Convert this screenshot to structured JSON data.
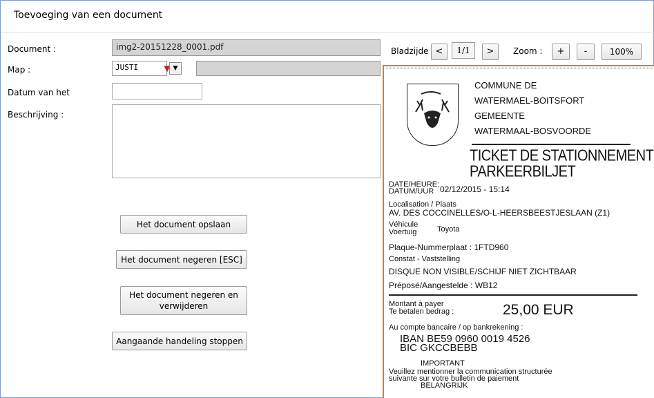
{
  "window": {
    "title": "Toevoeging van een document"
  },
  "form": {
    "document_label": "Document :",
    "document_value": "img2-20151228_0001.pdf",
    "map_label": "Map :",
    "map_value": "JUSTI",
    "date_label": "Datum van het",
    "date_value": "",
    "description_label": "Beschrijving :",
    "description_value": ""
  },
  "actions": {
    "save": "Het document opslaan",
    "ignore": "Het document negeren [ESC]",
    "ignore_delete": "Het document negeren en verwijderen",
    "stop": "Aangaande handeling stoppen"
  },
  "viewer": {
    "page_label": "Bladzijde",
    "prev": "<",
    "page_value": "1/1",
    "next": ">",
    "zoom_label": "Zoom :",
    "zoom_in": "+",
    "zoom_out": "-",
    "zoom_value": "100%"
  },
  "ticket": {
    "commune_line1": "COMMUNE DE",
    "commune_line2": "WATERMAEL-BOITSFORT",
    "commune_line3": "GEMEENTE",
    "commune_line4": "WATERMAAL-BOSVOORDE",
    "heading1": "TICKET DE STATIONNEMENT",
    "heading2": "PARKEERBILJET",
    "date_label1": "DATE/HEURE:",
    "date_label2": "DATUM/UUR",
    "date_value": "02/12/2015 - 15:14",
    "location_label": "Localisation / Plaats",
    "location_value": "AV. DES COCCINELLES/O-L-HEERSBEESTJESLAAN (Z1)",
    "vehicle_label1": "Véhicule",
    "vehicle_label2": "Voertuig",
    "vehicle_value": "Toyota",
    "plate_line": "Plaque-Nummerplaat : 1FTD960",
    "constat_line": "Constat - Vaststelling",
    "disque_line": "DISQUE NON VISIBLE/SCHIJF NIET ZICHTBAAR",
    "prepose_line": "Préposé/Aangestelde : WB12",
    "amount_label1": "Montant à payer",
    "amount_label2": "Te betalen bedrag :",
    "amount_value": "25,00 EUR",
    "account_line": "Au compte bancaire / op bankrekening :",
    "iban_line": "IBAN   BE59 0960 0019 4526",
    "bic_line": "BIC    GKCCBEBB",
    "important": "IMPORTANT",
    "notice_line1": "Veuillez mentionner la communication structurée",
    "notice_line2": "suivante sur votre bulletin de paiement",
    "belangrijk": "BELANGRIJK"
  }
}
